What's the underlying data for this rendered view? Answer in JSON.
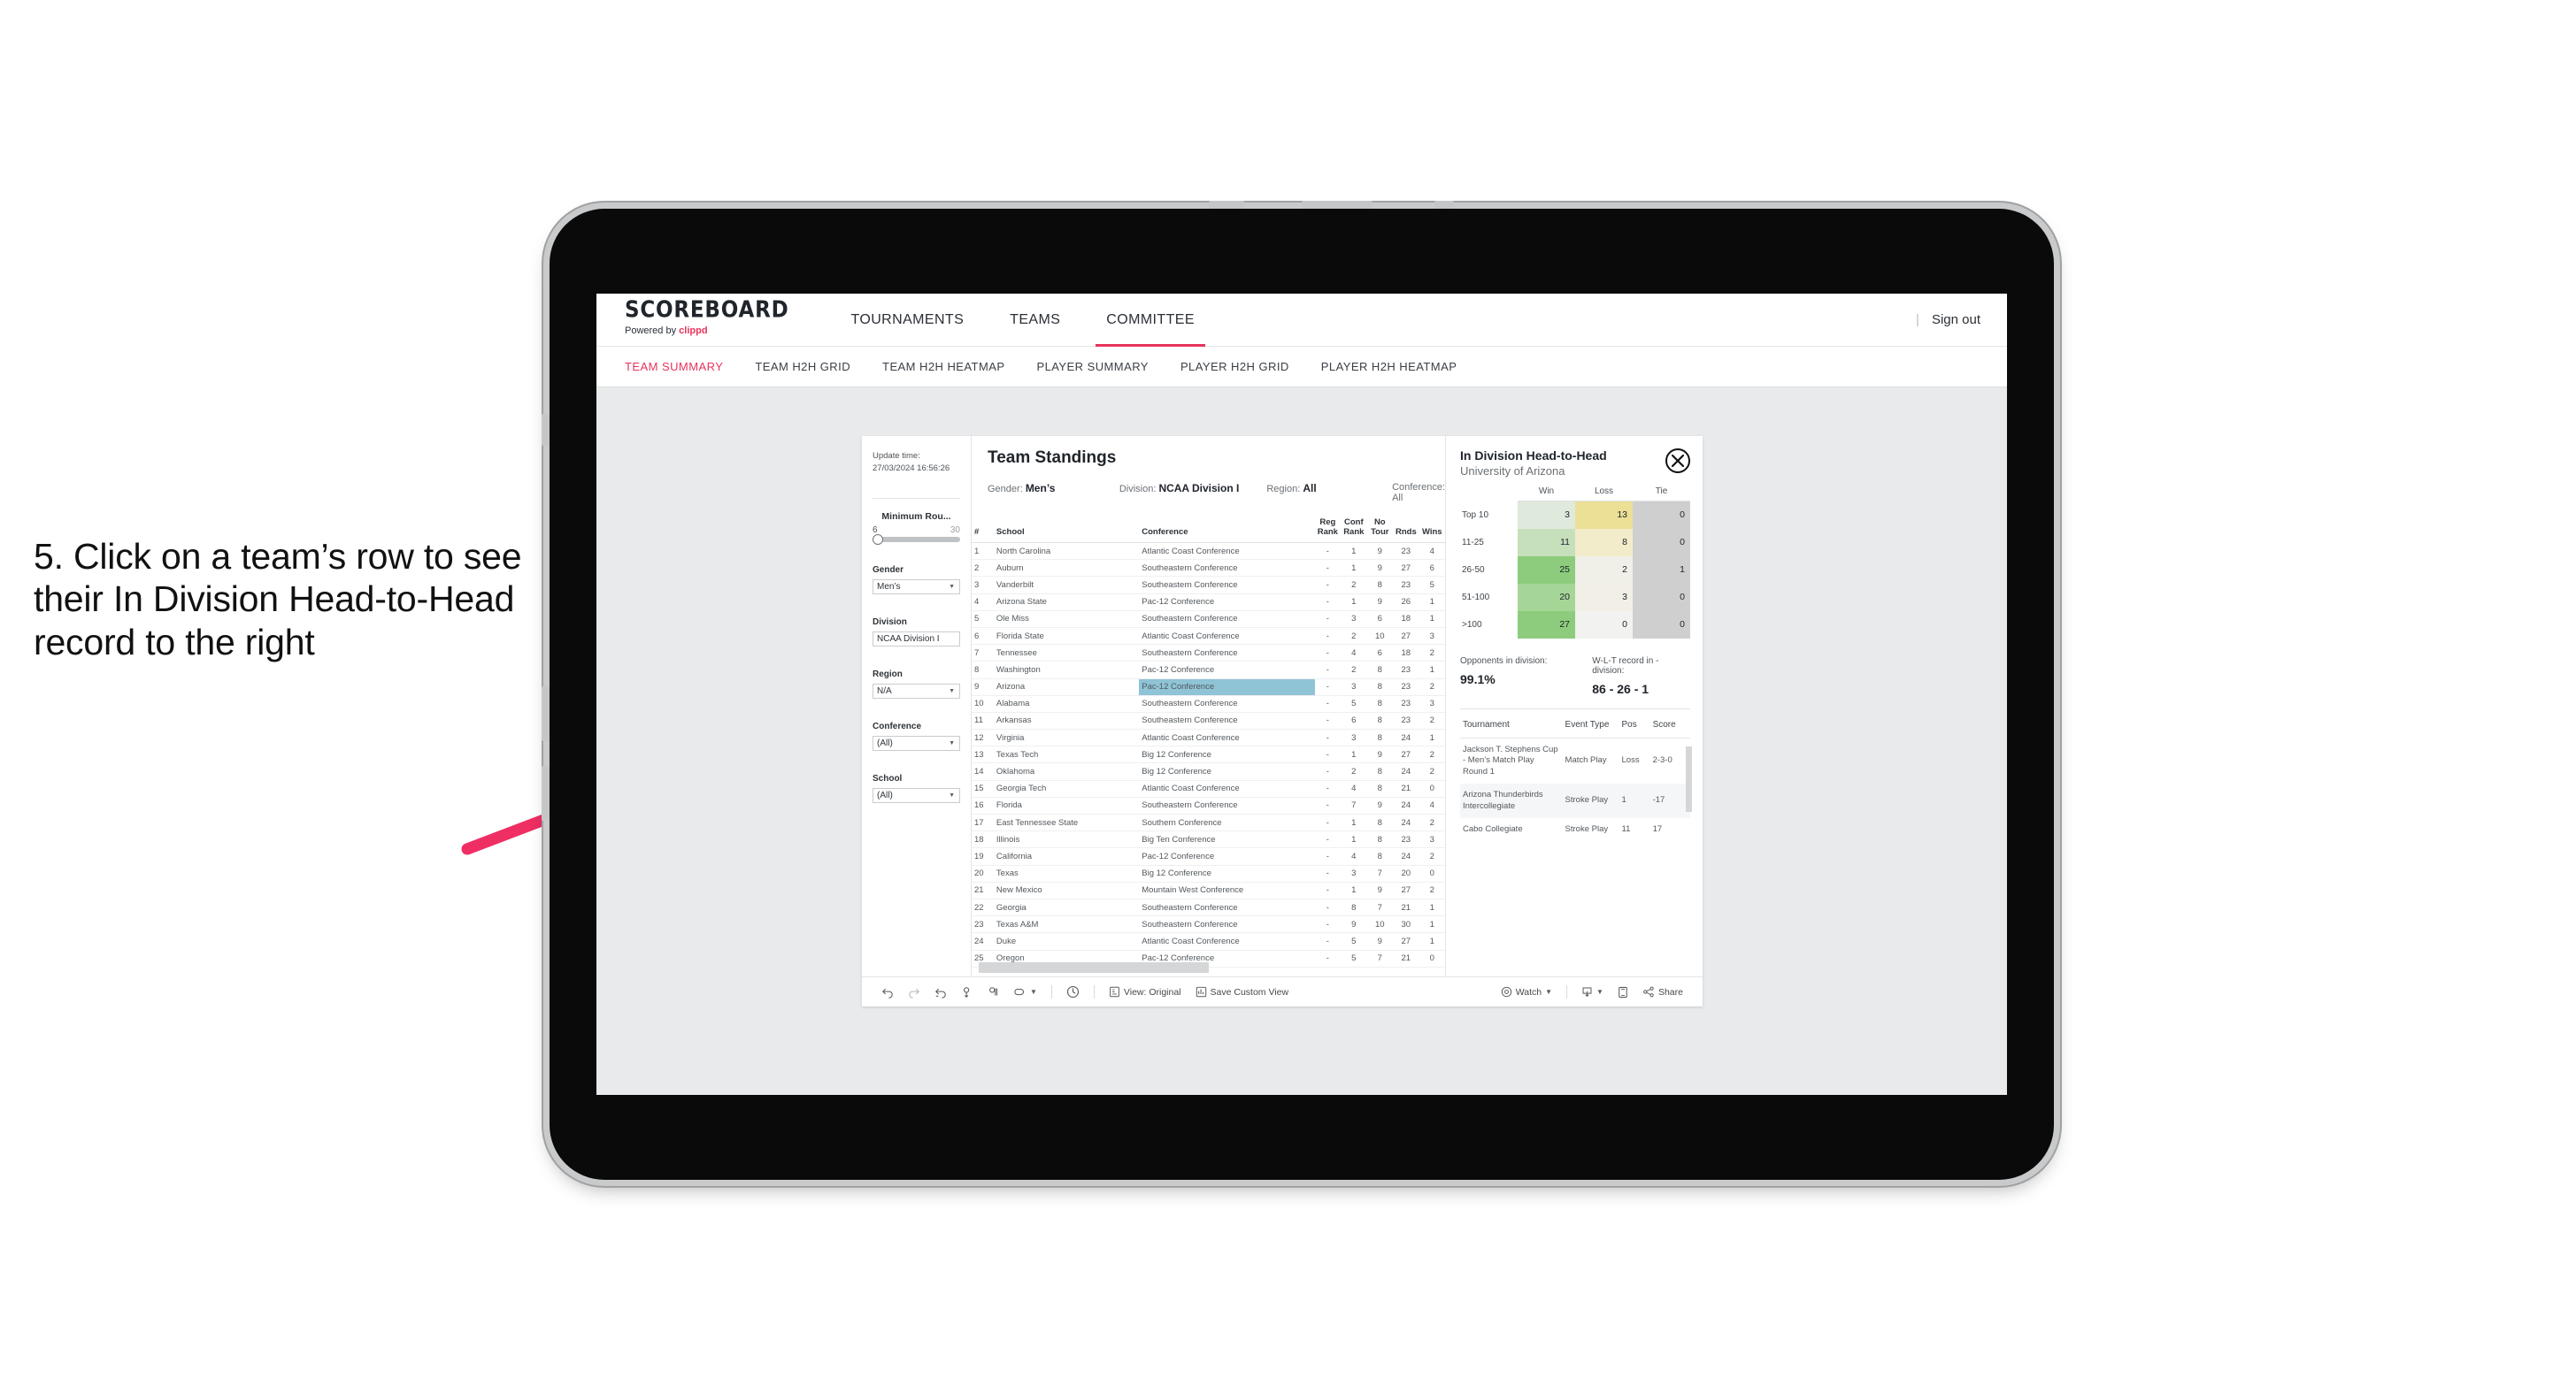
{
  "caption": "5. Click on a team’s row to see their In Division Head-to-Head record to the right",
  "colors": {
    "accent": "#e8335c",
    "highlight_row": "#8ec4d6",
    "arrow": "#ef2e63"
  },
  "header": {
    "logo_main": "SCOREBOARD",
    "logo_sub_prefix": "Powered by ",
    "logo_sub_brand": "clippd",
    "nav": [
      {
        "label": "TOURNAMENTS",
        "active": false
      },
      {
        "label": "TEAMS",
        "active": false
      },
      {
        "label": "COMMITTEE",
        "active": true
      }
    ],
    "separator": "|",
    "sign_out": "Sign out"
  },
  "subtabs": [
    {
      "label": "TEAM SUMMARY",
      "active": true
    },
    {
      "label": "TEAM H2H GRID",
      "active": false
    },
    {
      "label": "TEAM H2H HEATMAP",
      "active": false
    },
    {
      "label": "PLAYER SUMMARY",
      "active": false
    },
    {
      "label": "PLAYER H2H GRID",
      "active": false
    },
    {
      "label": "PLAYER H2H HEATMAP",
      "active": false
    }
  ],
  "filters": {
    "update_time_label": "Update time:",
    "update_time_value": "27/03/2024 16:56:26",
    "slider": {
      "label": "Minimum Rou...",
      "min": "6",
      "max": "30"
    },
    "controls": [
      {
        "label": "Gender",
        "value": "Men’s"
      },
      {
        "label": "Division",
        "value": "NCAA Division I"
      },
      {
        "label": "Region",
        "value": "N/A"
      },
      {
        "label": "Conference",
        "value": "(All)"
      },
      {
        "label": "School",
        "value": "(All)"
      }
    ]
  },
  "standings": {
    "title": "Team Standings",
    "filter_line": [
      {
        "key": "Gender: ",
        "value": "Men’s"
      },
      {
        "key": "Division: ",
        "value": "NCAA Division I"
      },
      {
        "key": "Region: ",
        "value": "All"
      },
      {
        "key": "Conference: ",
        "value": "All"
      }
    ],
    "columns": [
      "#",
      "School",
      "Conference",
      "Reg Rank",
      "Conf Rank",
      "No Tour",
      "Rnds",
      "Wins"
    ],
    "rows": [
      [
        "1",
        "North Carolina",
        "Atlantic Coast Conference",
        "-",
        "1",
        "9",
        "23",
        "4"
      ],
      [
        "2",
        "Auburn",
        "Southeastern Conference",
        "-",
        "1",
        "9",
        "27",
        "6"
      ],
      [
        "3",
        "Vanderbilt",
        "Southeastern Conference",
        "-",
        "2",
        "8",
        "23",
        "5"
      ],
      [
        "4",
        "Arizona State",
        "Pac-12 Conference",
        "-",
        "1",
        "9",
        "26",
        "1"
      ],
      [
        "5",
        "Ole Miss",
        "Southeastern Conference",
        "-",
        "3",
        "6",
        "18",
        "1"
      ],
      [
        "6",
        "Florida State",
        "Atlantic Coast Conference",
        "-",
        "2",
        "10",
        "27",
        "3"
      ],
      [
        "7",
        "Tennessee",
        "Southeastern Conference",
        "-",
        "4",
        "6",
        "18",
        "2"
      ],
      [
        "8",
        "Washington",
        "Pac-12 Conference",
        "-",
        "2",
        "8",
        "23",
        "1"
      ],
      [
        "9",
        "Arizona",
        "Pac-12 Conference",
        "-",
        "3",
        "8",
        "23",
        "2"
      ],
      [
        "10",
        "Alabama",
        "Southeastern Conference",
        "-",
        "5",
        "8",
        "23",
        "3"
      ],
      [
        "11",
        "Arkansas",
        "Southeastern Conference",
        "-",
        "6",
        "8",
        "23",
        "2"
      ],
      [
        "12",
        "Virginia",
        "Atlantic Coast Conference",
        "-",
        "3",
        "8",
        "24",
        "1"
      ],
      [
        "13",
        "Texas Tech",
        "Big 12 Conference",
        "-",
        "1",
        "9",
        "27",
        "2"
      ],
      [
        "14",
        "Oklahoma",
        "Big 12 Conference",
        "-",
        "2",
        "8",
        "24",
        "2"
      ],
      [
        "15",
        "Georgia Tech",
        "Atlantic Coast Conference",
        "-",
        "4",
        "8",
        "21",
        "0"
      ],
      [
        "16",
        "Florida",
        "Southeastern Conference",
        "-",
        "7",
        "9",
        "24",
        "4"
      ],
      [
        "17",
        "East Tennessee State",
        "Southern Conference",
        "-",
        "1",
        "8",
        "24",
        "2"
      ],
      [
        "18",
        "Illinois",
        "Big Ten Conference",
        "-",
        "1",
        "8",
        "23",
        "3"
      ],
      [
        "19",
        "California",
        "Pac-12 Conference",
        "-",
        "4",
        "8",
        "24",
        "2"
      ],
      [
        "20",
        "Texas",
        "Big 12 Conference",
        "-",
        "3",
        "7",
        "20",
        "0"
      ],
      [
        "21",
        "New Mexico",
        "Mountain West Conference",
        "-",
        "1",
        "9",
        "27",
        "2"
      ],
      [
        "22",
        "Georgia",
        "Southeastern Conference",
        "-",
        "8",
        "7",
        "21",
        "1"
      ],
      [
        "23",
        "Texas A&M",
        "Southeastern Conference",
        "-",
        "9",
        "10",
        "30",
        "1"
      ],
      [
        "24",
        "Duke",
        "Atlantic Coast Conference",
        "-",
        "5",
        "9",
        "27",
        "1"
      ],
      [
        "25",
        "Oregon",
        "Pac-12 Conference",
        "-",
        "5",
        "7",
        "21",
        "0"
      ]
    ],
    "selected_row_index": 8
  },
  "detail": {
    "title": "In Division Head-to-Head",
    "subtitle": "University of Arizona",
    "close_icon": "close-icon",
    "h2h": {
      "columns": [
        "Win",
        "Loss",
        "Tie"
      ],
      "rows": [
        {
          "band": "Top 10",
          "win": "3",
          "loss": "13",
          "tie": "0"
        },
        {
          "band": "11-25",
          "win": "11",
          "loss": "8",
          "tie": "0"
        },
        {
          "band": "26-50",
          "win": "25",
          "loss": "2",
          "tie": "1"
        },
        {
          "band": "51-100",
          "win": "20",
          "loss": "3",
          "tie": "0"
        },
        {
          "band": ">100",
          "win": "27",
          "loss": "0",
          "tie": "0"
        }
      ]
    },
    "stats": [
      {
        "label": "Opponents in division:",
        "value": "99.1%"
      },
      {
        "label": "W-L-T record in -division:",
        "value": "86 - 26 - 1"
      }
    ],
    "tournaments": {
      "columns": [
        "Tournament",
        "Event Type",
        "Pos",
        "Score"
      ],
      "rows": [
        [
          "Jackson T. Stephens Cup - Men’s Match Play Round 1",
          "Match Play",
          "Loss",
          "2-3-0"
        ],
        [
          "Arizona Thunderbirds Intercollegiate",
          "Stroke Play",
          "1",
          "-17"
        ],
        [
          "Cabo Collegiate",
          "Stroke Play",
          "11",
          "17"
        ]
      ]
    }
  },
  "toolbar": {
    "view_label": "View: Original",
    "save_label": "Save Custom View",
    "watch_label": "Watch",
    "share_label": "Share"
  },
  "chart_data": {
    "type": "heatmap",
    "title": "In Division Head-to-Head",
    "subtitle": "University of Arizona",
    "xlabel": "",
    "ylabel": "",
    "columns": [
      "Win",
      "Loss",
      "Tie"
    ],
    "rows": [
      "Top 10",
      "11-25",
      "26-50",
      "51-100",
      ">100"
    ],
    "values": [
      [
        3,
        13,
        0
      ],
      [
        11,
        8,
        0
      ],
      [
        25,
        2,
        1
      ],
      [
        20,
        3,
        0
      ],
      [
        27,
        0,
        0
      ]
    ],
    "cell_colors": [
      [
        "#dfeadd",
        "#ecdf96",
        "#cfcfcf"
      ],
      [
        "#c6e0bc",
        "#f3ecca",
        "#cfcfcf"
      ],
      [
        "#8ccc7c",
        "#f0efe8",
        "#cfcfcf"
      ],
      [
        "#a6d697",
        "#f2f0e6",
        "#cfcfcf"
      ],
      [
        "#8ccc7c",
        "#f2f2f0",
        "#cfcfcf"
      ]
    ],
    "legend": "none",
    "grid": false
  }
}
